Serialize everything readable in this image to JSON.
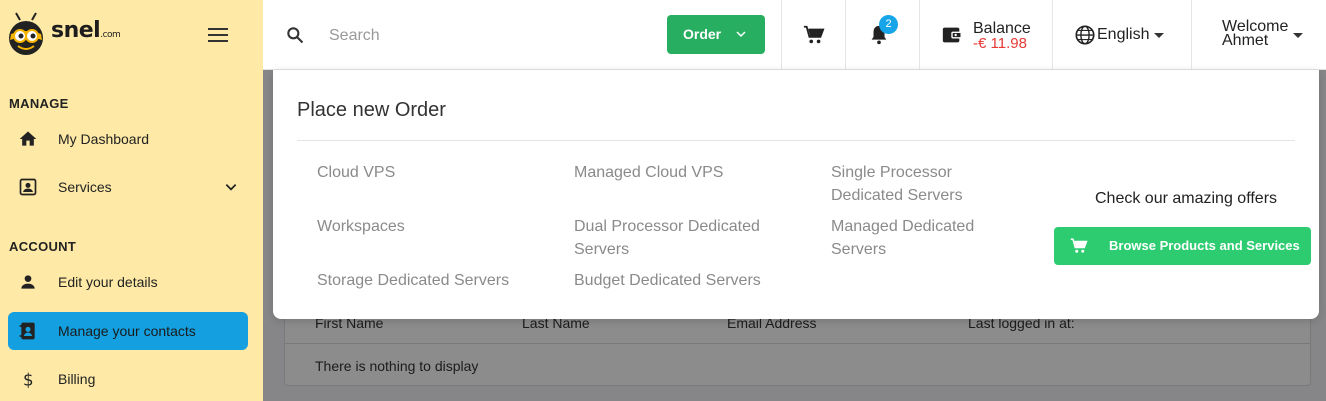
{
  "brand": {
    "name": "snel",
    "suffix": ".com"
  },
  "sidebar": {
    "manage_label": "MANAGE",
    "account_label": "ACCOUNT",
    "items": [
      {
        "label": "My Dashboard",
        "icon": "home-icon"
      },
      {
        "label": "Services",
        "icon": "contact-card-icon"
      },
      {
        "label": "Edit your details",
        "icon": "person-icon"
      },
      {
        "label": "Manage your contacts",
        "icon": "contacts-book-icon",
        "active": true
      },
      {
        "label": "Billing",
        "icon": "dollar-icon"
      }
    ]
  },
  "header": {
    "search_placeholder": "Search",
    "order_label": "Order",
    "notifications_count": "2",
    "balance_label": "Balance",
    "balance_value": "-€ 11.98",
    "language": "English",
    "welcome_line1": "Welcome",
    "welcome_line2": "Ahmet"
  },
  "order_panel": {
    "title": "Place new Order",
    "links": [
      "Cloud VPS",
      "Managed Cloud VPS",
      "Single Processor Dedicated Servers",
      "Workspaces",
      "Dual Processor Dedicated Servers",
      "Managed Dedicated Servers",
      "Storage Dedicated Servers",
      "Budget Dedicated Servers"
    ],
    "offers_text": "Check our amazing offers",
    "browse_label": "Browse Products and Services"
  },
  "contacts_table": {
    "headers": [
      "First Name",
      "Last Name",
      "Email Address",
      "Last logged in at:"
    ],
    "empty_message": "There is nothing to display"
  },
  "colors": {
    "sidebar_bg": "#feeaa6",
    "active_item": "#14a0e0",
    "order_button": "#27ae60",
    "browse_button": "#2ecc71",
    "balance_negative": "#e53935",
    "badge": "#16a5e8"
  }
}
